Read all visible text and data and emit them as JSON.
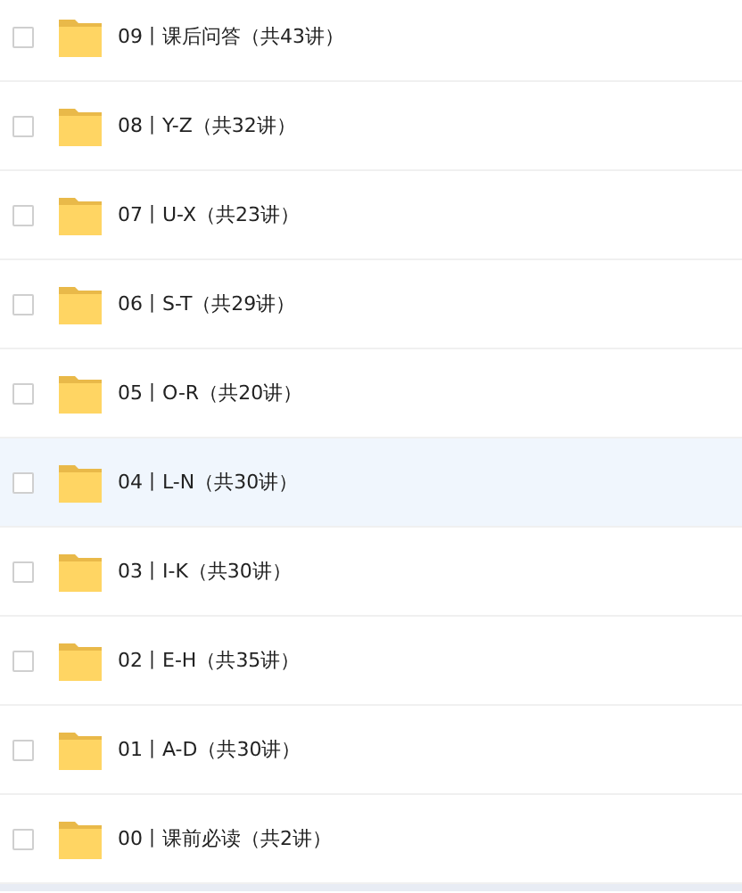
{
  "folders": [
    {
      "name": "09丨课后问答（共43讲）",
      "checked": false,
      "selected": false
    },
    {
      "name": "08丨Y-Z（共32讲）",
      "checked": false,
      "selected": false
    },
    {
      "name": "07丨U-X（共23讲）",
      "checked": false,
      "selected": false
    },
    {
      "name": "06丨S-T（共29讲）",
      "checked": false,
      "selected": false
    },
    {
      "name": "05丨O-R（共20讲）",
      "checked": false,
      "selected": false
    },
    {
      "name": "04丨L-N（共30讲）",
      "checked": false,
      "selected": true
    },
    {
      "name": "03丨I-K（共30讲）",
      "checked": false,
      "selected": false
    },
    {
      "name": "02丨E-H（共35讲）",
      "checked": false,
      "selected": false
    },
    {
      "name": "01丨A-D（共30讲）",
      "checked": false,
      "selected": false
    },
    {
      "name": "00丨课前必读（共2讲）",
      "checked": false,
      "selected": false
    }
  ]
}
